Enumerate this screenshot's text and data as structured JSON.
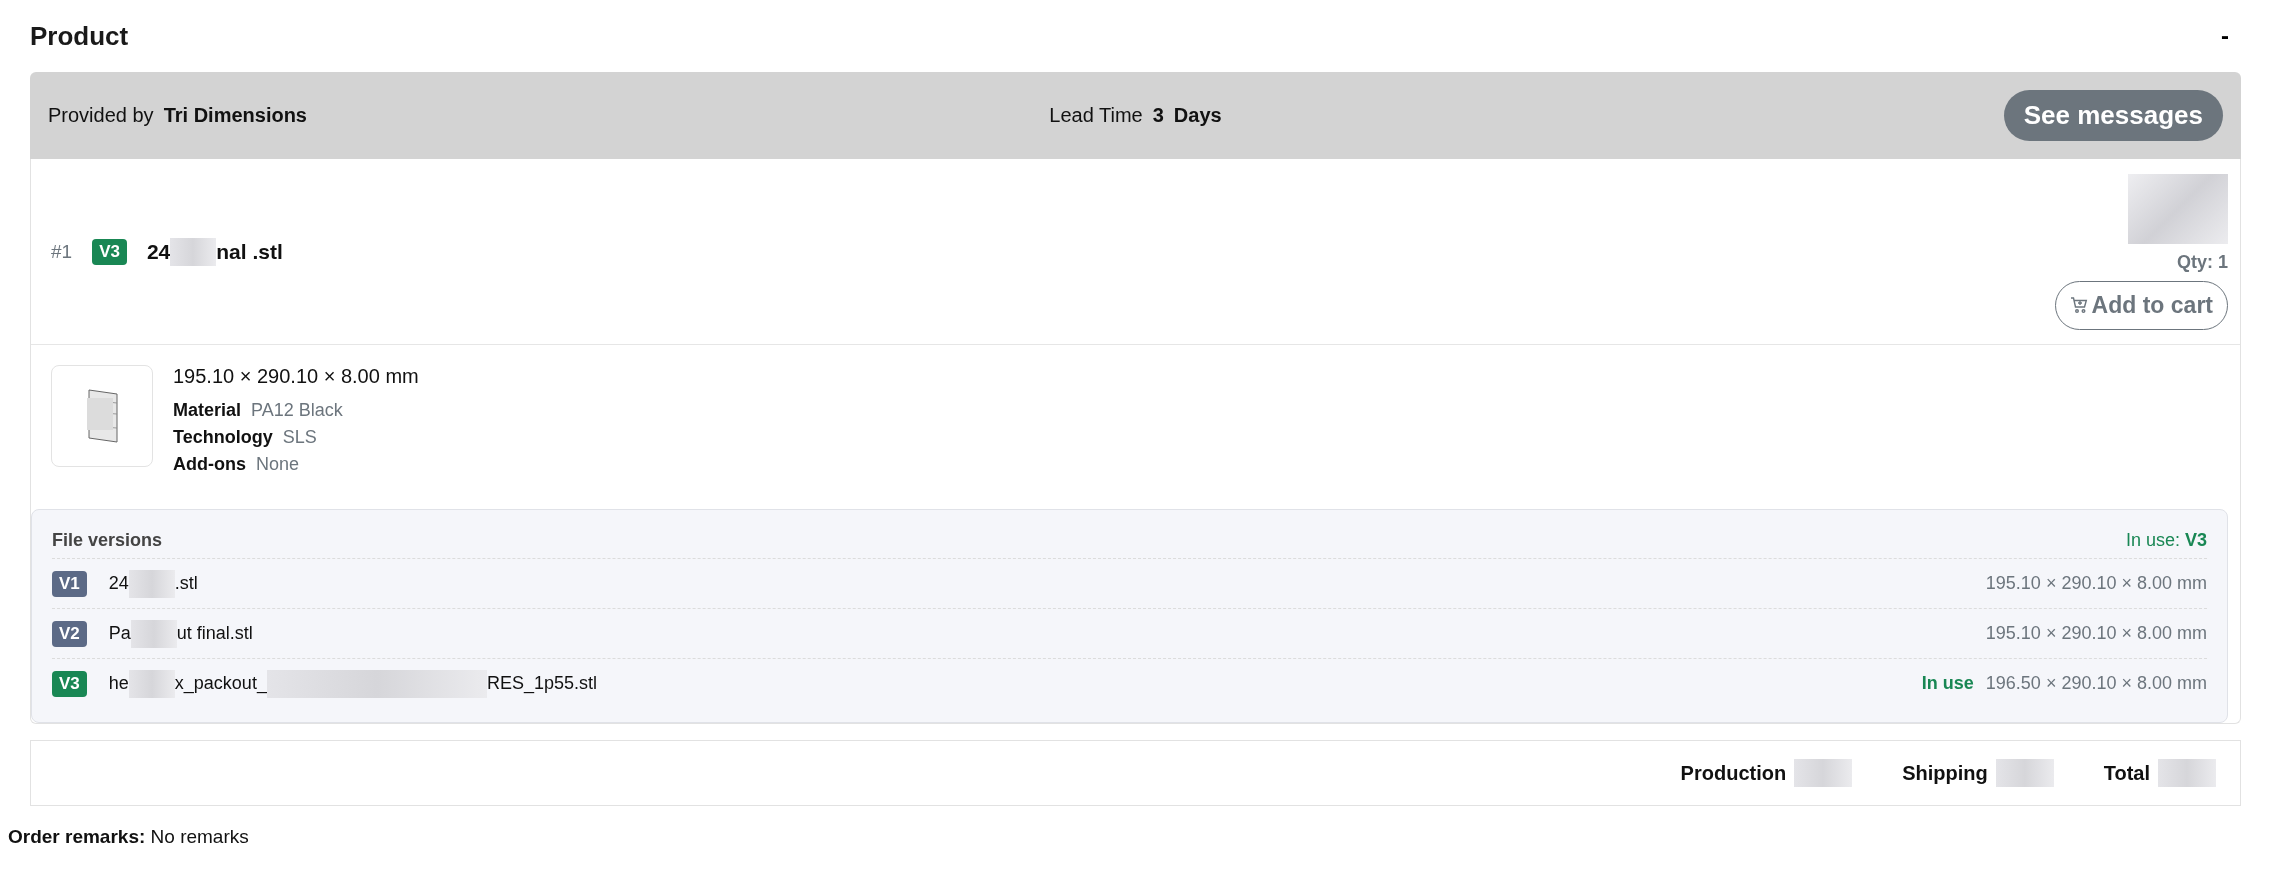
{
  "section": {
    "title": "Product",
    "collapse_label": "-"
  },
  "provider_bar": {
    "provided_by_label": "Provided by",
    "provider": "Tri Dimensions",
    "lead_time_label": "Lead Time",
    "lead_time_value": "3",
    "lead_time_unit": "Days",
    "messages_button": "See messages"
  },
  "item": {
    "number": "#1",
    "version": "V3",
    "name_parts": [
      "24",
      "nal .stl"
    ],
    "qty": "Qty: 1",
    "add_to_cart": "Add to cart",
    "dimensions": "195.10 × 290.10 × 8.00 mm",
    "specs": [
      {
        "label": "Material",
        "value": "PA12 Black"
      },
      {
        "label": "Technology",
        "value": "SLS"
      },
      {
        "label": "Add-ons",
        "value": "None"
      }
    ]
  },
  "file_versions": {
    "title": "File versions",
    "in_use_label": "In use:",
    "in_use_version": "V3",
    "rows": [
      {
        "version": "V1",
        "name_parts": [
          "24",
          ".stl"
        ],
        "in_use": false,
        "dimensions": "195.10 × 290.10 × 8.00 mm"
      },
      {
        "version": "V2",
        "name_parts": [
          "Pa",
          "ut final.stl"
        ],
        "in_use": false,
        "dimensions": "195.10 × 290.10 × 8.00 mm"
      },
      {
        "version": "V3",
        "name_parts": [
          "he",
          "x_packout_",
          "RES_1p55.stl"
        ],
        "in_use": true,
        "in_use_text": "In use",
        "dimensions": "196.50 × 290.10 × 8.00 mm"
      }
    ]
  },
  "totals": [
    {
      "label": "Production"
    },
    {
      "label": "Shipping"
    },
    {
      "label": "Total"
    }
  ],
  "order_remarks": {
    "label": "Order remarks:",
    "value": "No remarks"
  }
}
